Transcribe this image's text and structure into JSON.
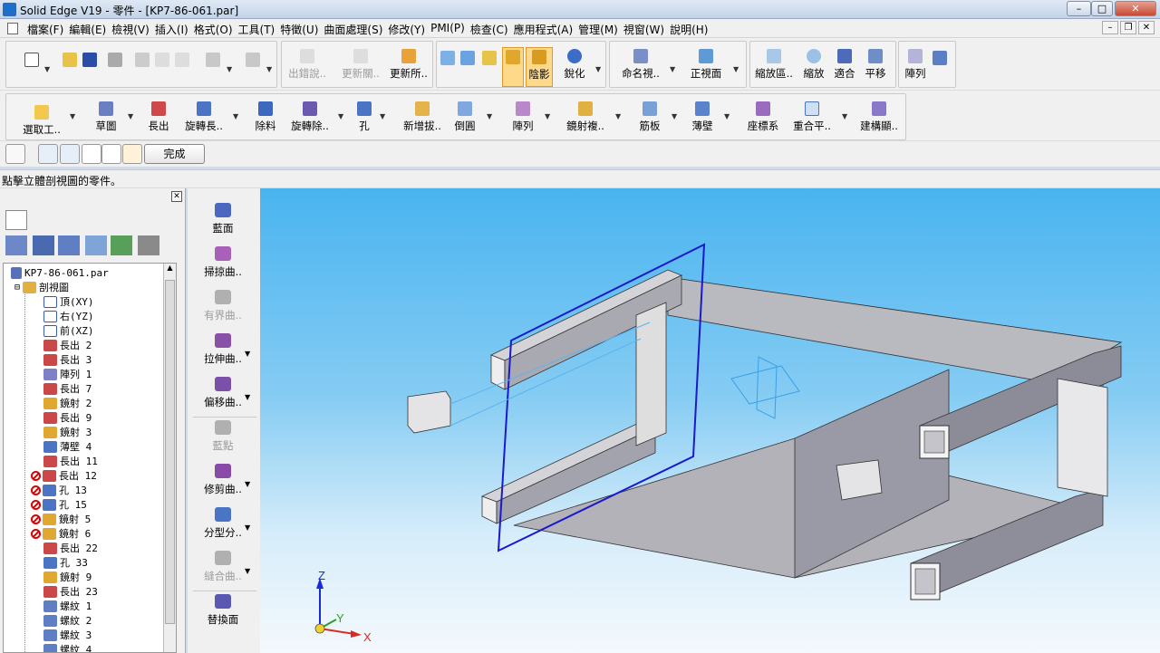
{
  "window": {
    "title": "Solid Edge V19 - 零件 - [KP7-86-061.par]"
  },
  "menu": [
    "檔案(F)",
    "編輯(E)",
    "檢視(V)",
    "插入(I)",
    "格式(O)",
    "工具(T)",
    "特徵(U)",
    "曲面處理(S)",
    "修改(Y)",
    "PMI(P)",
    "檢查(C)",
    "應用程式(A)",
    "管理(M)",
    "視窗(W)",
    "說明(H)"
  ],
  "toolbar1": {
    "groupA": [
      "出錯說..",
      "更新關..",
      "更新所.."
    ],
    "shade": "陰影",
    "sharpen": "銳化",
    "named_view": "命名視..",
    "front_view": "正視面",
    "zoom_area": "縮放區..",
    "zoom": "縮放",
    "fit": "適合",
    "pan": "平移",
    "array": "陣列"
  },
  "toolbar2": {
    "select": "選取工..",
    "sketch": "草圖",
    "extrude": "長出",
    "revolve": "旋轉長..",
    "cutout": "除料",
    "revolve_cut": "旋轉除..",
    "hole": "孔",
    "draft": "新增拔..",
    "round": "倒圓",
    "pattern": "陣列",
    "mirror": "鏡射複..",
    "rib": "筋板",
    "thinwall": "薄壁",
    "coord": "座標系",
    "coincident": "重合平..",
    "construct": "建構顯.."
  },
  "toolbar3": {
    "done": "完成"
  },
  "prompt": "點擊立體剖視圖的零件。",
  "palette": [
    {
      "label": "藍面",
      "enabled": true
    },
    {
      "label": "掃掠曲..",
      "enabled": true
    },
    {
      "label": "有界曲..",
      "enabled": false
    },
    {
      "label": "拉伸曲..",
      "enabled": true
    },
    {
      "label": "偏移曲..",
      "enabled": true
    },
    {
      "label": "藍點",
      "enabled": false
    },
    {
      "label": "修剪曲..",
      "enabled": true
    },
    {
      "label": "分型分..",
      "enabled": true
    },
    {
      "label": "縫合曲..",
      "enabled": false
    },
    {
      "label": "替換面",
      "enabled": true
    }
  ],
  "tree": {
    "root": "KP7-86-061.par",
    "section": "剖視圖",
    "items": [
      {
        "label": "頂(XY)",
        "icon": "plane-icon",
        "error": false
      },
      {
        "label": "右(YZ)",
        "icon": "plane-icon",
        "error": false
      },
      {
        "label": "前(XZ)",
        "icon": "plane-icon",
        "error": false
      },
      {
        "label": "長出 2",
        "icon": "extrude-icon",
        "error": false
      },
      {
        "label": "長出 3",
        "icon": "extrude-icon",
        "error": false
      },
      {
        "label": "陣列 1",
        "icon": "pattern-icon",
        "error": false
      },
      {
        "label": "長出 7",
        "icon": "extrude-icon",
        "error": false
      },
      {
        "label": "鏡射 2",
        "icon": "mirror-icon",
        "error": false
      },
      {
        "label": "長出 9",
        "icon": "extrude-icon",
        "error": false
      },
      {
        "label": "鏡射 3",
        "icon": "mirror-icon",
        "error": false
      },
      {
        "label": "薄壁 4",
        "icon": "thinwall-icon",
        "error": false
      },
      {
        "label": "長出 11",
        "icon": "extrude-icon",
        "error": false
      },
      {
        "label": "長出 12",
        "icon": "extrude-icon",
        "error": true
      },
      {
        "label": "孔 13",
        "icon": "hole-icon",
        "error": true
      },
      {
        "label": "孔 15",
        "icon": "hole-icon",
        "error": true
      },
      {
        "label": "鏡射 5",
        "icon": "mirror-icon",
        "error": true
      },
      {
        "label": "鏡射 6",
        "icon": "mirror-icon",
        "error": true
      },
      {
        "label": "長出 22",
        "icon": "extrude-icon",
        "error": false
      },
      {
        "label": "孔 33",
        "icon": "hole-icon",
        "error": false
      },
      {
        "label": "鏡射 9",
        "icon": "mirror-icon",
        "error": false
      },
      {
        "label": "長出 23",
        "icon": "extrude-icon",
        "error": false
      },
      {
        "label": "螺紋 1",
        "icon": "thread-icon",
        "error": false
      },
      {
        "label": "螺紋 2",
        "icon": "thread-icon",
        "error": false
      },
      {
        "label": "螺紋 3",
        "icon": "thread-icon",
        "error": false
      },
      {
        "label": "螺紋 4",
        "icon": "thread-icon",
        "error": false
      }
    ]
  },
  "triad": {
    "x": "X",
    "y": "Y",
    "z": "Z"
  },
  "colors": {
    "viewport_top": "#49b4f0",
    "viewport_bottom": "#f4f9fd",
    "part_face": "#a5a5ad",
    "part_face_light": "#d6d6dc",
    "section_plane": "#1a1acc",
    "error": "#dd0000"
  }
}
